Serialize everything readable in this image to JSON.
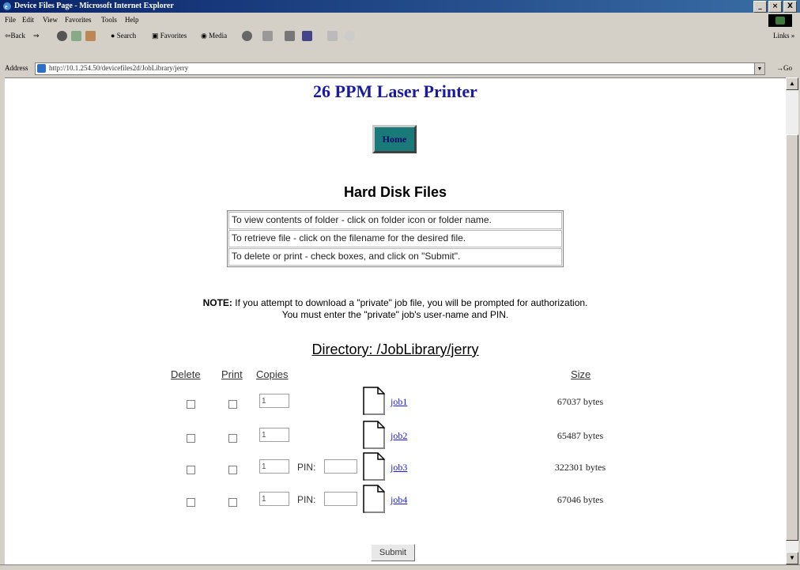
{
  "window": {
    "title": "Device Files Page - Microsoft Internet Explorer",
    "buttons": [
      "_",
      "×",
      "X"
    ]
  },
  "menubar": [
    "File",
    "Edit",
    "View",
    "Favorites",
    "Tools",
    "Help"
  ],
  "toolbar": {
    "back": "⇦Back",
    "search": "Search",
    "favorites": "Favorites",
    "media": "Media",
    "links": "Links »"
  },
  "address": {
    "label": "Address",
    "url": "http://10.1.254.50/devicefiles2d/JobLibrary/jerry",
    "go": "Go"
  },
  "page": {
    "title": "26 PPM Laser Printer",
    "home_label": "Home",
    "section_title": "Hard Disk Files",
    "instructions": [
      "To view contents of folder - click on folder icon or folder name.",
      "To retrieve file - click on the filename for the desired file.",
      "To delete or print - check boxes, and click on \"Submit\"."
    ],
    "note_label": "NOTE:",
    "note_line1": "If you attempt to download a \"private\" job file, you will be prompted for authorization.",
    "note_line2": "You must enter the \"private\" job's user-name and PIN.",
    "directory_label": "Directory:",
    "directory_path": "/JobLibrary/jerry",
    "columns": {
      "delete": "Delete",
      "print": "Print",
      "copies": "Copies",
      "size": "Size"
    },
    "pin_label": "PIN:",
    "files": [
      {
        "name": "job1",
        "copies": "1",
        "size": "67037 bytes",
        "private": false
      },
      {
        "name": "job2",
        "copies": "1",
        "size": "65487 bytes",
        "private": false
      },
      {
        "name": "job3",
        "copies": "1",
        "size": "322301 bytes",
        "private": true
      },
      {
        "name": "job4",
        "copies": "1",
        "size": "67046 bytes",
        "private": true
      }
    ],
    "submit_label": "Submit"
  }
}
